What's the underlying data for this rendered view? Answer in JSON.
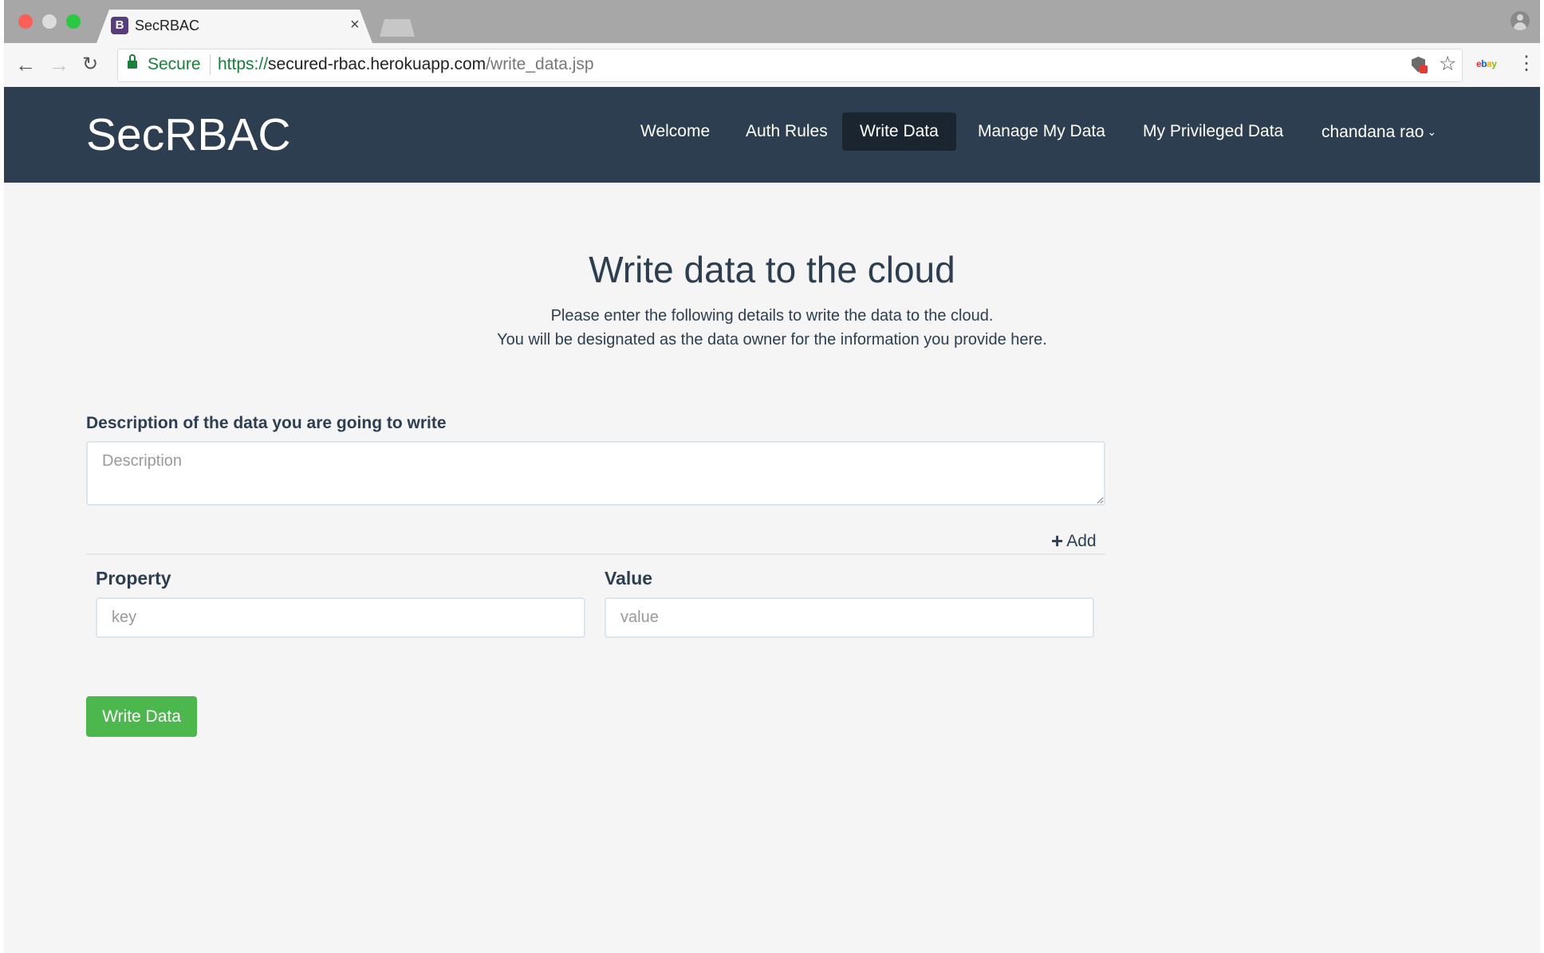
{
  "browser": {
    "tab_title": "SecRBAC",
    "tab_favicon_letter": "B",
    "tab_close": "×",
    "secure_label": "Secure",
    "url_scheme": "https://",
    "url_host": "secured-rbac.herokuapp.com",
    "url_path": "/write_data.jsp",
    "icons": [
      "back-icon",
      "forward-icon",
      "reload-icon",
      "lock-icon",
      "shield-icon",
      "star-icon",
      "ebay-extension-icon",
      "menu-icon",
      "profile-icon"
    ],
    "ebay_letters": [
      {
        "char": "e",
        "color": "#e53238"
      },
      {
        "char": "b",
        "color": "#0064d2"
      },
      {
        "char": "a",
        "color": "#f5af02"
      },
      {
        "char": "y",
        "color": "#86b817"
      }
    ]
  },
  "navbar": {
    "brand": "SecRBAC",
    "items": [
      {
        "label": "Welcome",
        "active": false
      },
      {
        "label": "Auth Rules",
        "active": false
      },
      {
        "label": "Write Data",
        "active": true
      },
      {
        "label": "Manage My Data",
        "active": false
      },
      {
        "label": "My Privileged Data",
        "active": false
      }
    ],
    "user_menu": {
      "label": "chandana rao",
      "icon": "chevron-down-icon"
    },
    "background": "#2c3e50"
  },
  "main": {
    "heading": "Write data to the cloud",
    "subtitle_line1": "Please enter the following details to write the data to the cloud.",
    "subtitle_line2": "You will be designated as the data owner for the information you provide here.",
    "description_label": "Description of the data you are going to write",
    "description_placeholder": "Description",
    "description_value": "",
    "add_label": "Add",
    "add_icon": "plus-icon",
    "property_label": "Property",
    "value_label": "Value",
    "key_placeholder": "key",
    "value_placeholder": "value",
    "submit_label": "Write Data",
    "submit_color": "#4cb74c"
  }
}
